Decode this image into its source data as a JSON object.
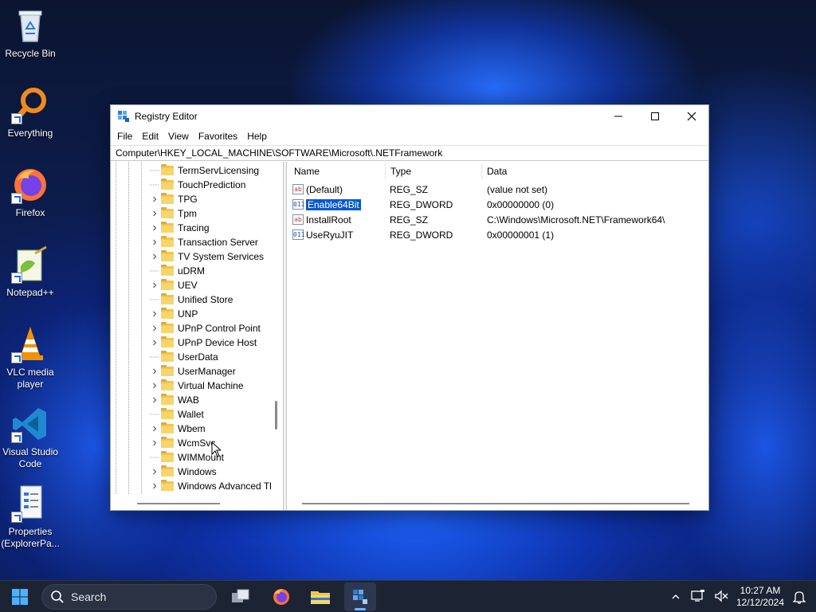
{
  "desktop": {
    "icons": [
      {
        "label": "Recycle Bin",
        "icon": "recycle-bin-icon"
      },
      {
        "label": "Everything",
        "icon": "everything-search-icon"
      },
      {
        "label": "Firefox",
        "icon": "firefox-icon"
      },
      {
        "label": "Notepad++",
        "icon": "notepad-plus-plus-icon"
      },
      {
        "label": "VLC media player",
        "icon": "vlc-icon"
      },
      {
        "label": "Visual Studio Code",
        "icon": "vscode-icon"
      },
      {
        "label": "Properties (ExplorerPa...",
        "icon": "properties-icon"
      }
    ]
  },
  "window": {
    "title": "Registry Editor",
    "menu": [
      "File",
      "Edit",
      "View",
      "Favorites",
      "Help"
    ],
    "address": "Computer\\HKEY_LOCAL_MACHINE\\SOFTWARE\\Microsoft\\.NETFramework"
  },
  "tree": {
    "items": [
      {
        "label": "TermServLicensing",
        "expandable": false
      },
      {
        "label": "TouchPrediction",
        "expandable": false
      },
      {
        "label": "TPG",
        "expandable": true
      },
      {
        "label": "Tpm",
        "expandable": true
      },
      {
        "label": "Tracing",
        "expandable": true
      },
      {
        "label": "Transaction Server",
        "expandable": true
      },
      {
        "label": "TV System Services",
        "expandable": true
      },
      {
        "label": "uDRM",
        "expandable": false
      },
      {
        "label": "UEV",
        "expandable": true
      },
      {
        "label": "Unified Store",
        "expandable": false
      },
      {
        "label": "UNP",
        "expandable": true
      },
      {
        "label": "UPnP Control Point",
        "expandable": true
      },
      {
        "label": "UPnP Device Host",
        "expandable": true
      },
      {
        "label": "UserData",
        "expandable": false
      },
      {
        "label": "UserManager",
        "expandable": true
      },
      {
        "label": "Virtual Machine",
        "expandable": true
      },
      {
        "label": "WAB",
        "expandable": true
      },
      {
        "label": "Wallet",
        "expandable": false
      },
      {
        "label": "Wbem",
        "expandable": true
      },
      {
        "label": "WcmSvc",
        "expandable": true
      },
      {
        "label": "WIMMount",
        "expandable": false
      },
      {
        "label": "Windows",
        "expandable": true
      },
      {
        "label": "Windows Advanced Tl",
        "expandable": true
      }
    ]
  },
  "values": {
    "headers": {
      "name": "Name",
      "type": "Type",
      "data": "Data"
    },
    "rows": [
      {
        "name": "(Default)",
        "type": "REG_SZ",
        "data": "(value not set)",
        "kind": "string",
        "selected": false
      },
      {
        "name": "Enable64Bit",
        "type": "REG_DWORD",
        "data": "0x00000000 (0)",
        "kind": "binary",
        "selected": true
      },
      {
        "name": "InstallRoot",
        "type": "REG_SZ",
        "data": "C:\\Windows\\Microsoft.NET\\Framework64\\",
        "kind": "string",
        "selected": false
      },
      {
        "name": "UseRyuJIT",
        "type": "REG_DWORD",
        "data": "0x00000001 (1)",
        "kind": "binary",
        "selected": false
      }
    ]
  },
  "taskbar": {
    "search_placeholder": "Search",
    "apps": [
      "task-view-icon",
      "firefox-icon",
      "file-explorer-icon",
      "registry-editor-icon"
    ],
    "time": "10:27 AM",
    "date": "12/12/2024"
  },
  "colors": {
    "selection": "#0a58d0",
    "taskbar": "#1c2333",
    "folder": "#f3c54c"
  }
}
